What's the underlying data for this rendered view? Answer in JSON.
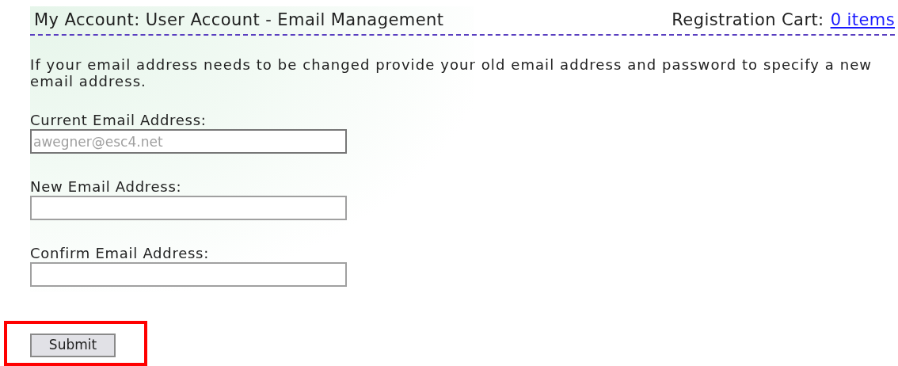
{
  "header": {
    "title": "My Account: User Account - Email Management",
    "cart_label": "Registration Cart:",
    "cart_link": "0 items"
  },
  "intro": "If your email address needs to be changed provide your old email address and password to specify a new email address.",
  "fields": [
    {
      "label": "Current Email Address:",
      "value": "awegner@esc4.net",
      "disabled": true
    },
    {
      "label": "New Email Address:",
      "disabled": false
    },
    {
      "label": "Confirm Email Address:",
      "disabled": false
    }
  ],
  "submit": {
    "label": "Submit",
    "highlighted": true
  }
}
